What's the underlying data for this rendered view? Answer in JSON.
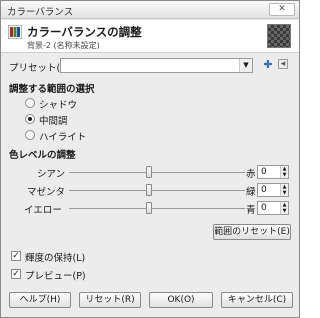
{
  "window": {
    "title": "カラーバランス",
    "close_label": "✕"
  },
  "header": {
    "title": "カラーバランスの調整",
    "subtitle": "背景-2 (名称未設定)"
  },
  "preset": {
    "label": "プリセット(S):",
    "value": ""
  },
  "range": {
    "heading": "調整する範囲の選択",
    "options": [
      {
        "label": "シャドウ",
        "selected": false
      },
      {
        "label": "中間調",
        "selected": true
      },
      {
        "label": "ハイライト",
        "selected": false
      }
    ]
  },
  "levels": {
    "heading": "色レベルの調整",
    "rows": [
      {
        "left": "シアン",
        "right": "赤",
        "value": "0",
        "position": 0.5
      },
      {
        "left": "マゼンタ",
        "right": "緑",
        "value": "0",
        "position": 0.5
      },
      {
        "left": "イエロー",
        "right": "青",
        "value": "0",
        "position": 0.5
      }
    ],
    "reset_range": "範囲のリセット(E)"
  },
  "options": {
    "preserve": {
      "label": "輝度の保持(L)",
      "checked": true
    },
    "preview": {
      "label": "プレビュー(P)",
      "checked": true
    }
  },
  "buttons": {
    "help": "ヘルプ(H)",
    "reset": "リセット(R)",
    "ok": "OK(O)",
    "cancel": "キャンセル(C)"
  },
  "colors": {
    "window_bg": "#ececec",
    "header_bg": "#ffffff"
  }
}
